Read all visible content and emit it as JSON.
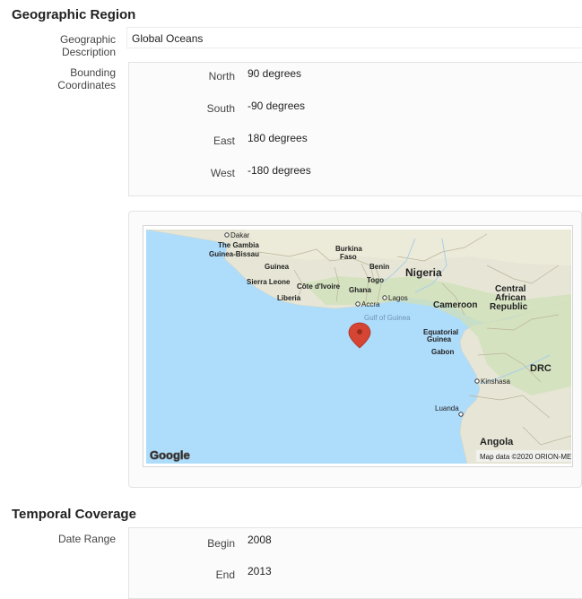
{
  "geographic": {
    "title": "Geographic Region",
    "description_label": "Geographic Description",
    "description_value": "Global Oceans",
    "bounding_label": "Bounding Coordinates",
    "coords": [
      {
        "name": "North",
        "value": "90  degrees"
      },
      {
        "name": "South",
        "value": "-90  degrees"
      },
      {
        "name": "East",
        "value": "180  degrees"
      },
      {
        "name": "West",
        "value": "-180  degrees"
      }
    ]
  },
  "map": {
    "places": {
      "dakar": "Dakar",
      "gambia": "The Gambia",
      "guinea_bissau": "Guinea-Bissau",
      "guinea": "Guinea",
      "sierra_leone": "Sierra Leone",
      "liberia": "Liberia",
      "cote_divoire": "Côte d'Ivoire",
      "burkina_1": "Burkina",
      "burkina_2": "Faso",
      "ghana": "Ghana",
      "togo": "Togo",
      "benin": "Benin",
      "nigeria": "Nigeria",
      "accra": "Accra",
      "lagos": "Lagos",
      "gulf": "Gulf of Guinea",
      "cameroon": "Cameroon",
      "car_1": "Central",
      "car_2": "African",
      "car_3": "Republic",
      "eq_guinea_1": "Equatorial",
      "eq_guinea_2": "Guinea",
      "gabon": "Gabon",
      "drc": "DRC",
      "kinshasa": "Kinshasa",
      "luanda": "Luanda",
      "angola": "Angola"
    },
    "logo": "Google",
    "attribution": "Map data ©2020 ORION-ME",
    "colors": {
      "ocean": "#aedcfb",
      "land": "#e7e6d6",
      "marker": "#d64534"
    }
  },
  "temporal": {
    "title": "Temporal Coverage",
    "range_label": "Date Range",
    "begin_label": "Begin",
    "begin_value": "2008",
    "end_label": "End",
    "end_value": "2013"
  }
}
